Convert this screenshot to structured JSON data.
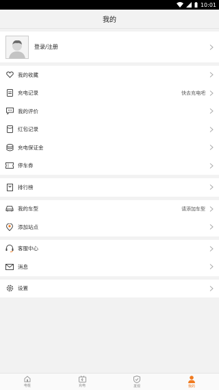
{
  "status_bar": {
    "time": "10:01"
  },
  "header": {
    "title": "我的"
  },
  "profile": {
    "login_label": "登录/注册"
  },
  "groups": [
    {
      "items": [
        {
          "label": "我的收藏",
          "icon": "heart-icon"
        },
        {
          "label": "充电记录",
          "icon": "document-icon",
          "hint": "快去充电吧"
        },
        {
          "label": "我的评价",
          "icon": "comment-icon"
        },
        {
          "label": "红包记录",
          "icon": "red-envelope-icon"
        },
        {
          "label": "充电保证金",
          "icon": "coin-stack-icon"
        },
        {
          "label": "停车券",
          "icon": "ticket-icon"
        }
      ]
    },
    {
      "items": [
        {
          "label": "排行榜",
          "icon": "ranking-icon"
        }
      ]
    },
    {
      "items": [
        {
          "label": "我的车型",
          "icon": "car-icon",
          "hint": "请添加车型"
        },
        {
          "label": "添加站点",
          "icon": "location-pin-icon"
        }
      ]
    },
    {
      "items": [
        {
          "label": "客服中心",
          "icon": "headset-icon"
        },
        {
          "label": "消息",
          "icon": "mail-icon"
        }
      ]
    },
    {
      "items": [
        {
          "label": "设置",
          "icon": "gear-icon"
        }
      ]
    }
  ],
  "tabs": [
    {
      "label": "电桩",
      "icon": "home-icon"
    },
    {
      "label": "充电",
      "icon": "charge-icon"
    },
    {
      "label": "发现",
      "icon": "discover-icon"
    },
    {
      "label": "我的",
      "icon": "person-icon",
      "active": true
    }
  ],
  "colors": {
    "accent": "#f07a1f",
    "text": "#333333",
    "background": "#f2f2f2"
  }
}
